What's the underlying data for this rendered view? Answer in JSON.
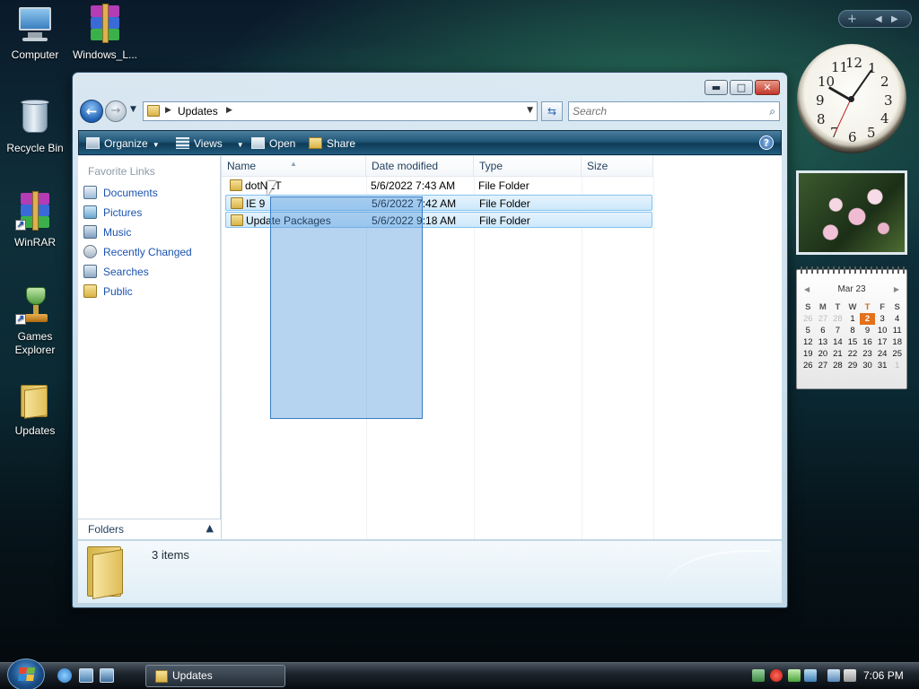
{
  "desktop": {
    "icons": [
      {
        "label": "Computer"
      },
      {
        "label": "Windows_L..."
      },
      {
        "label": "Recycle Bin"
      },
      {
        "label": "WinRAR"
      },
      {
        "label": "Games Explorer"
      },
      {
        "label": "Updates"
      }
    ]
  },
  "window": {
    "caption": {
      "minimize": "▬",
      "maximize": "□",
      "close": "✕"
    },
    "address": {
      "crumb": "Updates"
    },
    "search": {
      "placeholder": "Search"
    },
    "toolbar": {
      "organize": "Organize",
      "views": "Views",
      "open": "Open",
      "share": "Share",
      "help": "?"
    },
    "nav_pane": {
      "heading": "Favorite Links",
      "links": [
        {
          "label": "Documents",
          "icon": "documents-icon"
        },
        {
          "label": "Pictures",
          "icon": "pictures-icon"
        },
        {
          "label": "Music",
          "icon": "music-icon"
        },
        {
          "label": "Recently Changed",
          "icon": "recently-changed-icon"
        },
        {
          "label": "Searches",
          "icon": "searches-icon"
        },
        {
          "label": "Public",
          "icon": "public-folder-icon"
        }
      ],
      "folders_label": "Folders"
    },
    "columns": [
      "Name",
      "Date modified",
      "Type",
      "Size"
    ],
    "files": [
      {
        "name": "dotNET",
        "date": "5/6/2022 7:43 AM",
        "type": "File Folder",
        "size": ""
      },
      {
        "name": "IE 9",
        "date": "5/6/2022 7:42 AM",
        "type": "File Folder",
        "size": ""
      },
      {
        "name": "Update Packages",
        "date": "5/6/2022 9:18 AM",
        "type": "File Folder",
        "size": ""
      }
    ],
    "details": {
      "item_count": "3 items"
    }
  },
  "gadgets": {
    "calendar": {
      "month": "Mar 23",
      "weekdays": [
        "S",
        "M",
        "T",
        "W",
        "T",
        "F",
        "S"
      ],
      "today": "2"
    }
  },
  "taskbar": {
    "task": "Updates",
    "clock": "7:06 PM"
  },
  "colors": {
    "accent": "#1b53b0",
    "selection": "#cde8fb",
    "today": "#e3701b"
  }
}
